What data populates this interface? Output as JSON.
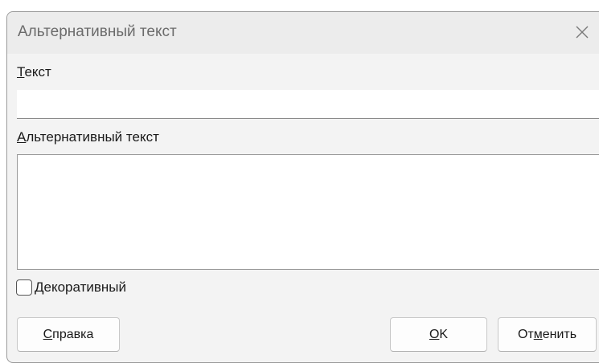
{
  "dialog": {
    "title": "Альтернативный текст",
    "close_icon": "close-icon"
  },
  "text_section": {
    "label_mnemonic": "Т",
    "label_rest": "екст",
    "value": ""
  },
  "alt_section": {
    "label_mnemonic": "А",
    "label_rest": "льтернативный текст",
    "value": ""
  },
  "decorative": {
    "label_mnemonic": "Д",
    "label_rest": "екоративный",
    "checked": false
  },
  "buttons": {
    "help_mnemonic": "С",
    "help_rest": "правка",
    "ok_mnemonic": "O",
    "ok_rest": "K",
    "cancel_pre": "От",
    "cancel_mnemonic": "м",
    "cancel_post": "енить"
  }
}
